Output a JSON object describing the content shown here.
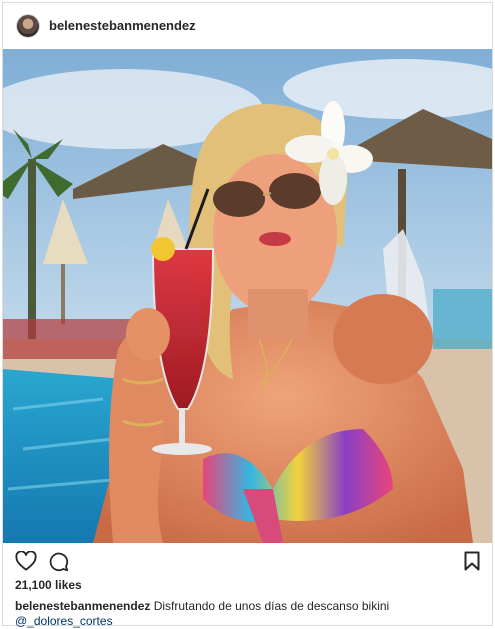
{
  "post": {
    "username": "belenestebanmenendez",
    "likes": "21,100 likes",
    "caption_user": "belenestebanmenendez",
    "caption_text": "Disfrutando de unos días de descanso bikini",
    "mention": "@_dolores_cortes",
    "photo_alt": "Photo by belenestebanmenendez"
  },
  "icons": {
    "like": "heart-outline-icon",
    "comment": "speech-bubble-icon",
    "save": "bookmark-icon"
  },
  "colors": {
    "text": "#262626",
    "border": "#dbdbdb",
    "link": "#003569"
  }
}
